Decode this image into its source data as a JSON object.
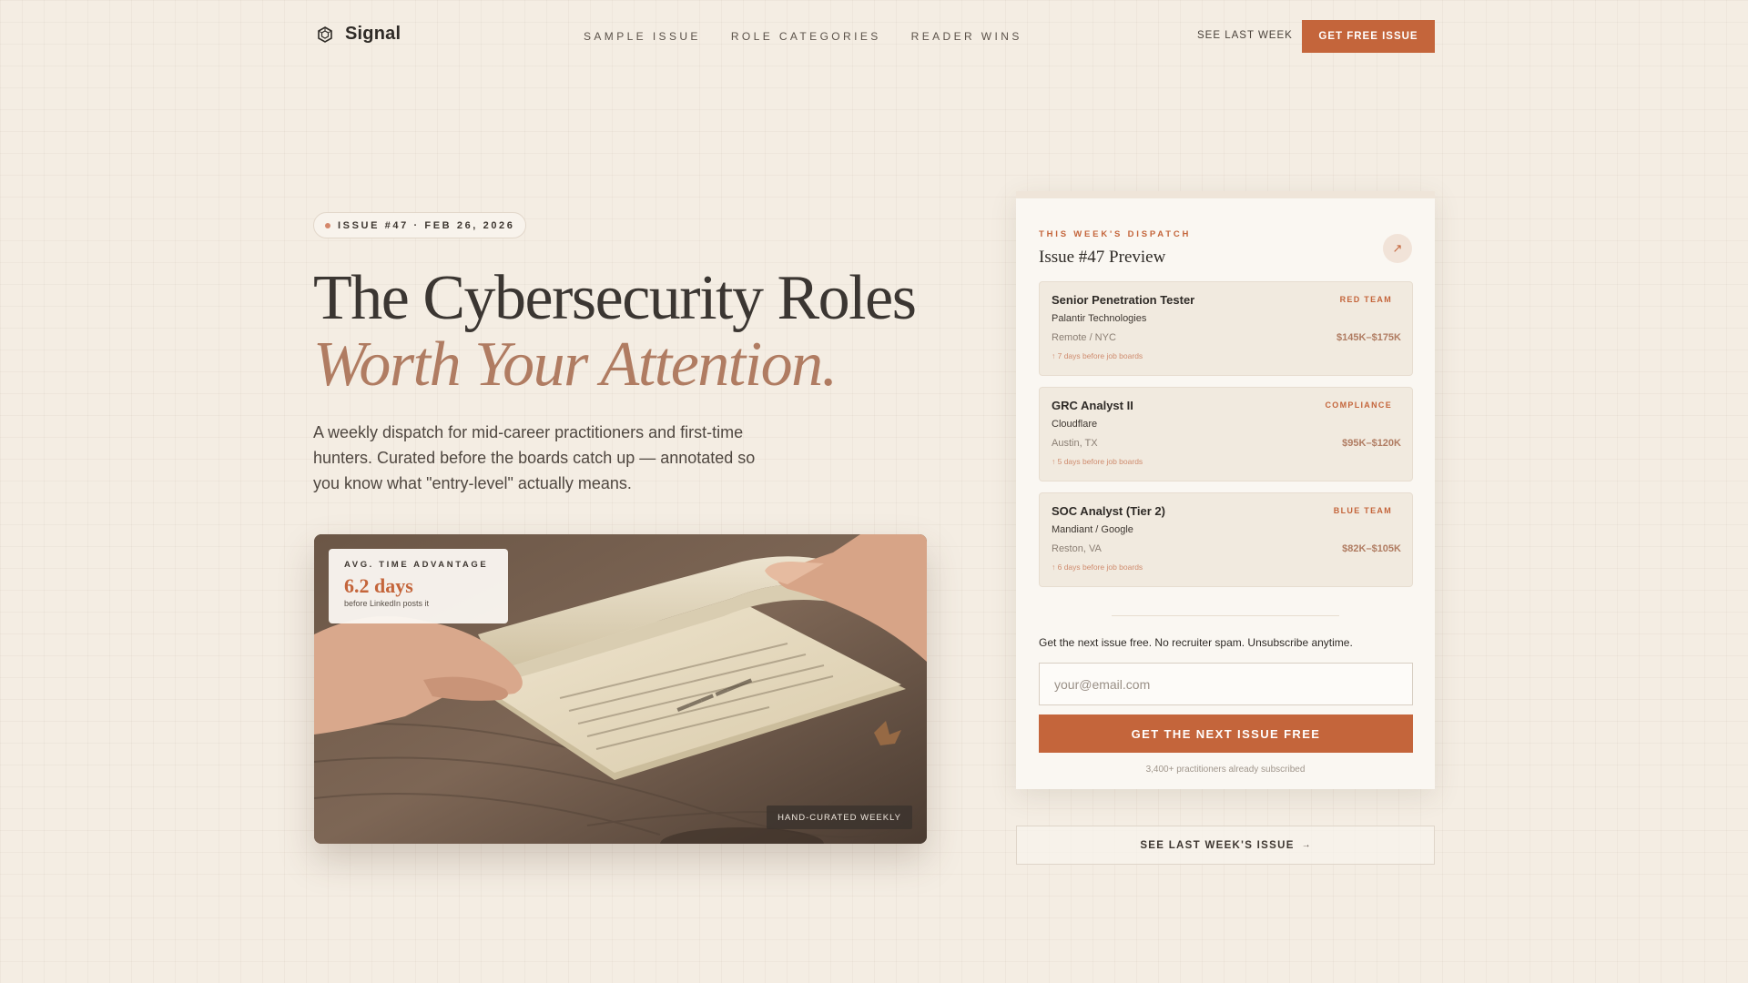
{
  "nav": {
    "brand": "Signal",
    "brand_icon": "hexagon-logo-icon",
    "links": [
      "SAMPLE ISSUE",
      "ROLE CATEGORIES",
      "READER WINS"
    ],
    "see_last_week": "SEE LAST WEEK",
    "get_free_issue": "GET FREE ISSUE"
  },
  "hero": {
    "issue_pill": "ISSUE #47 · FEB 26, 2026",
    "title_line1": "The Cybersecurity Roles",
    "title_line2": "Worth Your Attention.",
    "subtitle": "A weekly dispatch for mid-career practitioners and first-time hunters. Curated before the boards catch up — annotated so you know what \"entry-level\" actually means."
  },
  "photo": {
    "stat_label": "AVG. TIME ADVANTAGE",
    "stat_value": "6.2 days",
    "stat_note": "before LinkedIn posts it",
    "tag": "HAND-CURATED WEEKLY"
  },
  "card": {
    "eyebrow": "THIS WEEK'S DISPATCH",
    "title": "Issue #47 Preview",
    "arrow_icon": "arrow-up-right-icon",
    "jobs": [
      {
        "title": "Senior Penetration Tester",
        "tag": "RED TEAM",
        "company": "Palantir Technologies",
        "location": "Remote / NYC",
        "pay": "$145K–$175K",
        "lead": "↑ 7 days before job boards"
      },
      {
        "title": "GRC Analyst II",
        "tag": "COMPLIANCE",
        "company": "Cloudflare",
        "location": "Austin, TX",
        "pay": "$95K–$120K",
        "lead": "↑ 5 days before job boards"
      },
      {
        "title": "SOC Analyst (Tier 2)",
        "tag": "BLUE TEAM",
        "company": "Mandiant / Google",
        "location": "Reston, VA",
        "pay": "$82K–$105K",
        "lead": "↑ 6 days before job boards"
      }
    ],
    "cta_text": "Get the next issue free. No recruiter spam. Unsubscribe anytime.",
    "email_placeholder": "your@email.com",
    "submit": "GET THE NEXT ISSUE FREE",
    "subscribers": "3,400+ practitioners already subscribed"
  },
  "last_issue": {
    "label": "SEE LAST WEEK'S ISSUE",
    "arrow": "→"
  },
  "colors": {
    "accent": "#c4653b",
    "accent_soft": "#b07c62",
    "background": "#f4ede3"
  }
}
